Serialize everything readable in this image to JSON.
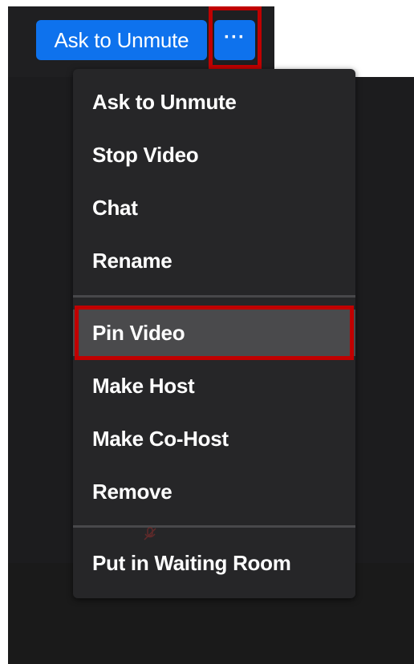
{
  "toolbar": {
    "ask_to_unmute_label": "Ask to Unmute",
    "more_label": "···",
    "accent_color": "#0e72ed",
    "highlight_color": "#c00000"
  },
  "menu": {
    "items": [
      {
        "label": "Ask to Unmute"
      },
      {
        "label": "Stop Video"
      },
      {
        "label": "Chat"
      },
      {
        "label": "Rename"
      },
      {
        "label": "Pin Video",
        "highlighted": true
      },
      {
        "label": "Make Host"
      },
      {
        "label": "Make Co-Host"
      },
      {
        "label": "Remove"
      },
      {
        "label": "Put in Waiting Room"
      }
    ]
  },
  "icons": {
    "more": "more-options-icon",
    "mic_muted": "microphone-muted-icon"
  }
}
